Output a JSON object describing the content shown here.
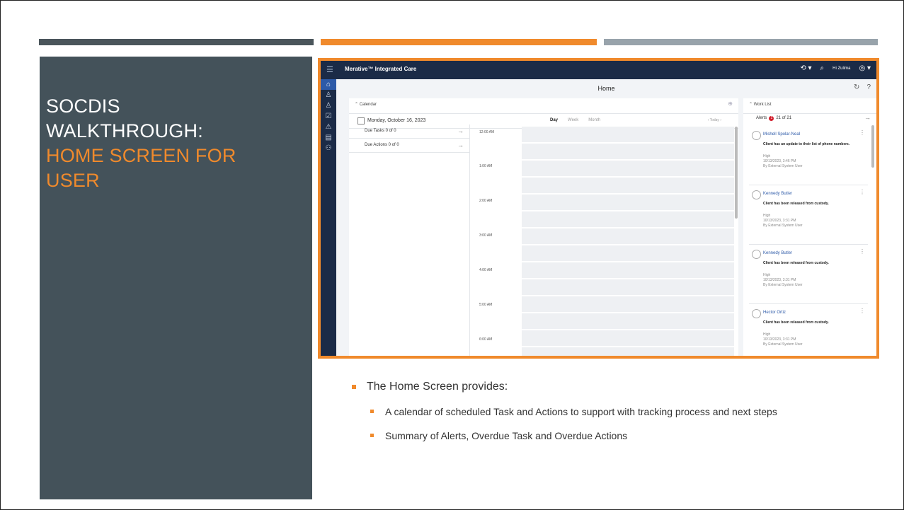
{
  "slide": {
    "title_line1": "SOCDIS",
    "title_line2": "WALKTHROUGH:",
    "title_accent1": "HOME SCREEN FOR",
    "title_accent2": "USER",
    "accent_color": "#f08a2c",
    "panel_color": "#44525a"
  },
  "app": {
    "brand": "Merative™ Integrated Care",
    "greeting": "Hi Zulima",
    "page_title": "Home",
    "calendar_label": "Calendar",
    "date": "Monday, October 16, 2023",
    "view_day": "Day",
    "view_week": "Week",
    "view_month": "Month",
    "today": "Today",
    "due_tasks": "Due Tasks  0 of 0",
    "due_actions": "Due Actions  0 of 0",
    "times": [
      "12:00 AM",
      "1:00 AM",
      "2:00 AM",
      "3:00 AM",
      "4:00 AM",
      "5:00 AM",
      "6:00 AM"
    ],
    "worklist_label": "Work List",
    "alerts_label": "Alerts",
    "alerts_count": "1",
    "alerts_range": "21 of 21",
    "alerts": [
      {
        "name": "Mishell Spolar-Neal",
        "message": "Client has an update to their list of phone numbers.",
        "priority": "High",
        "time": "10/13/2023, 3:46 PM",
        "by": "By External System User"
      },
      {
        "name": "Kennedy Butler",
        "message": "Client has been released from custody.",
        "priority": "High",
        "time": "10/13/2023, 3:31 PM",
        "by": "By External System User"
      },
      {
        "name": "Kennedy Butler",
        "message": "Client has been released from custody.",
        "priority": "High",
        "time": "10/13/2023, 3:31 PM",
        "by": "By External System User"
      },
      {
        "name": "Hector Ortiz",
        "message": "Client has been released from custody.",
        "priority": "High",
        "time": "10/13/2023, 3:31 PM",
        "by": "By External System User"
      }
    ]
  },
  "bullets": {
    "main": "The Home Screen provides:",
    "sub1": "A calendar of scheduled Task and Actions to support with tracking process and next steps",
    "sub2": "Summary of Alerts, Overdue Task and Overdue Actions"
  }
}
